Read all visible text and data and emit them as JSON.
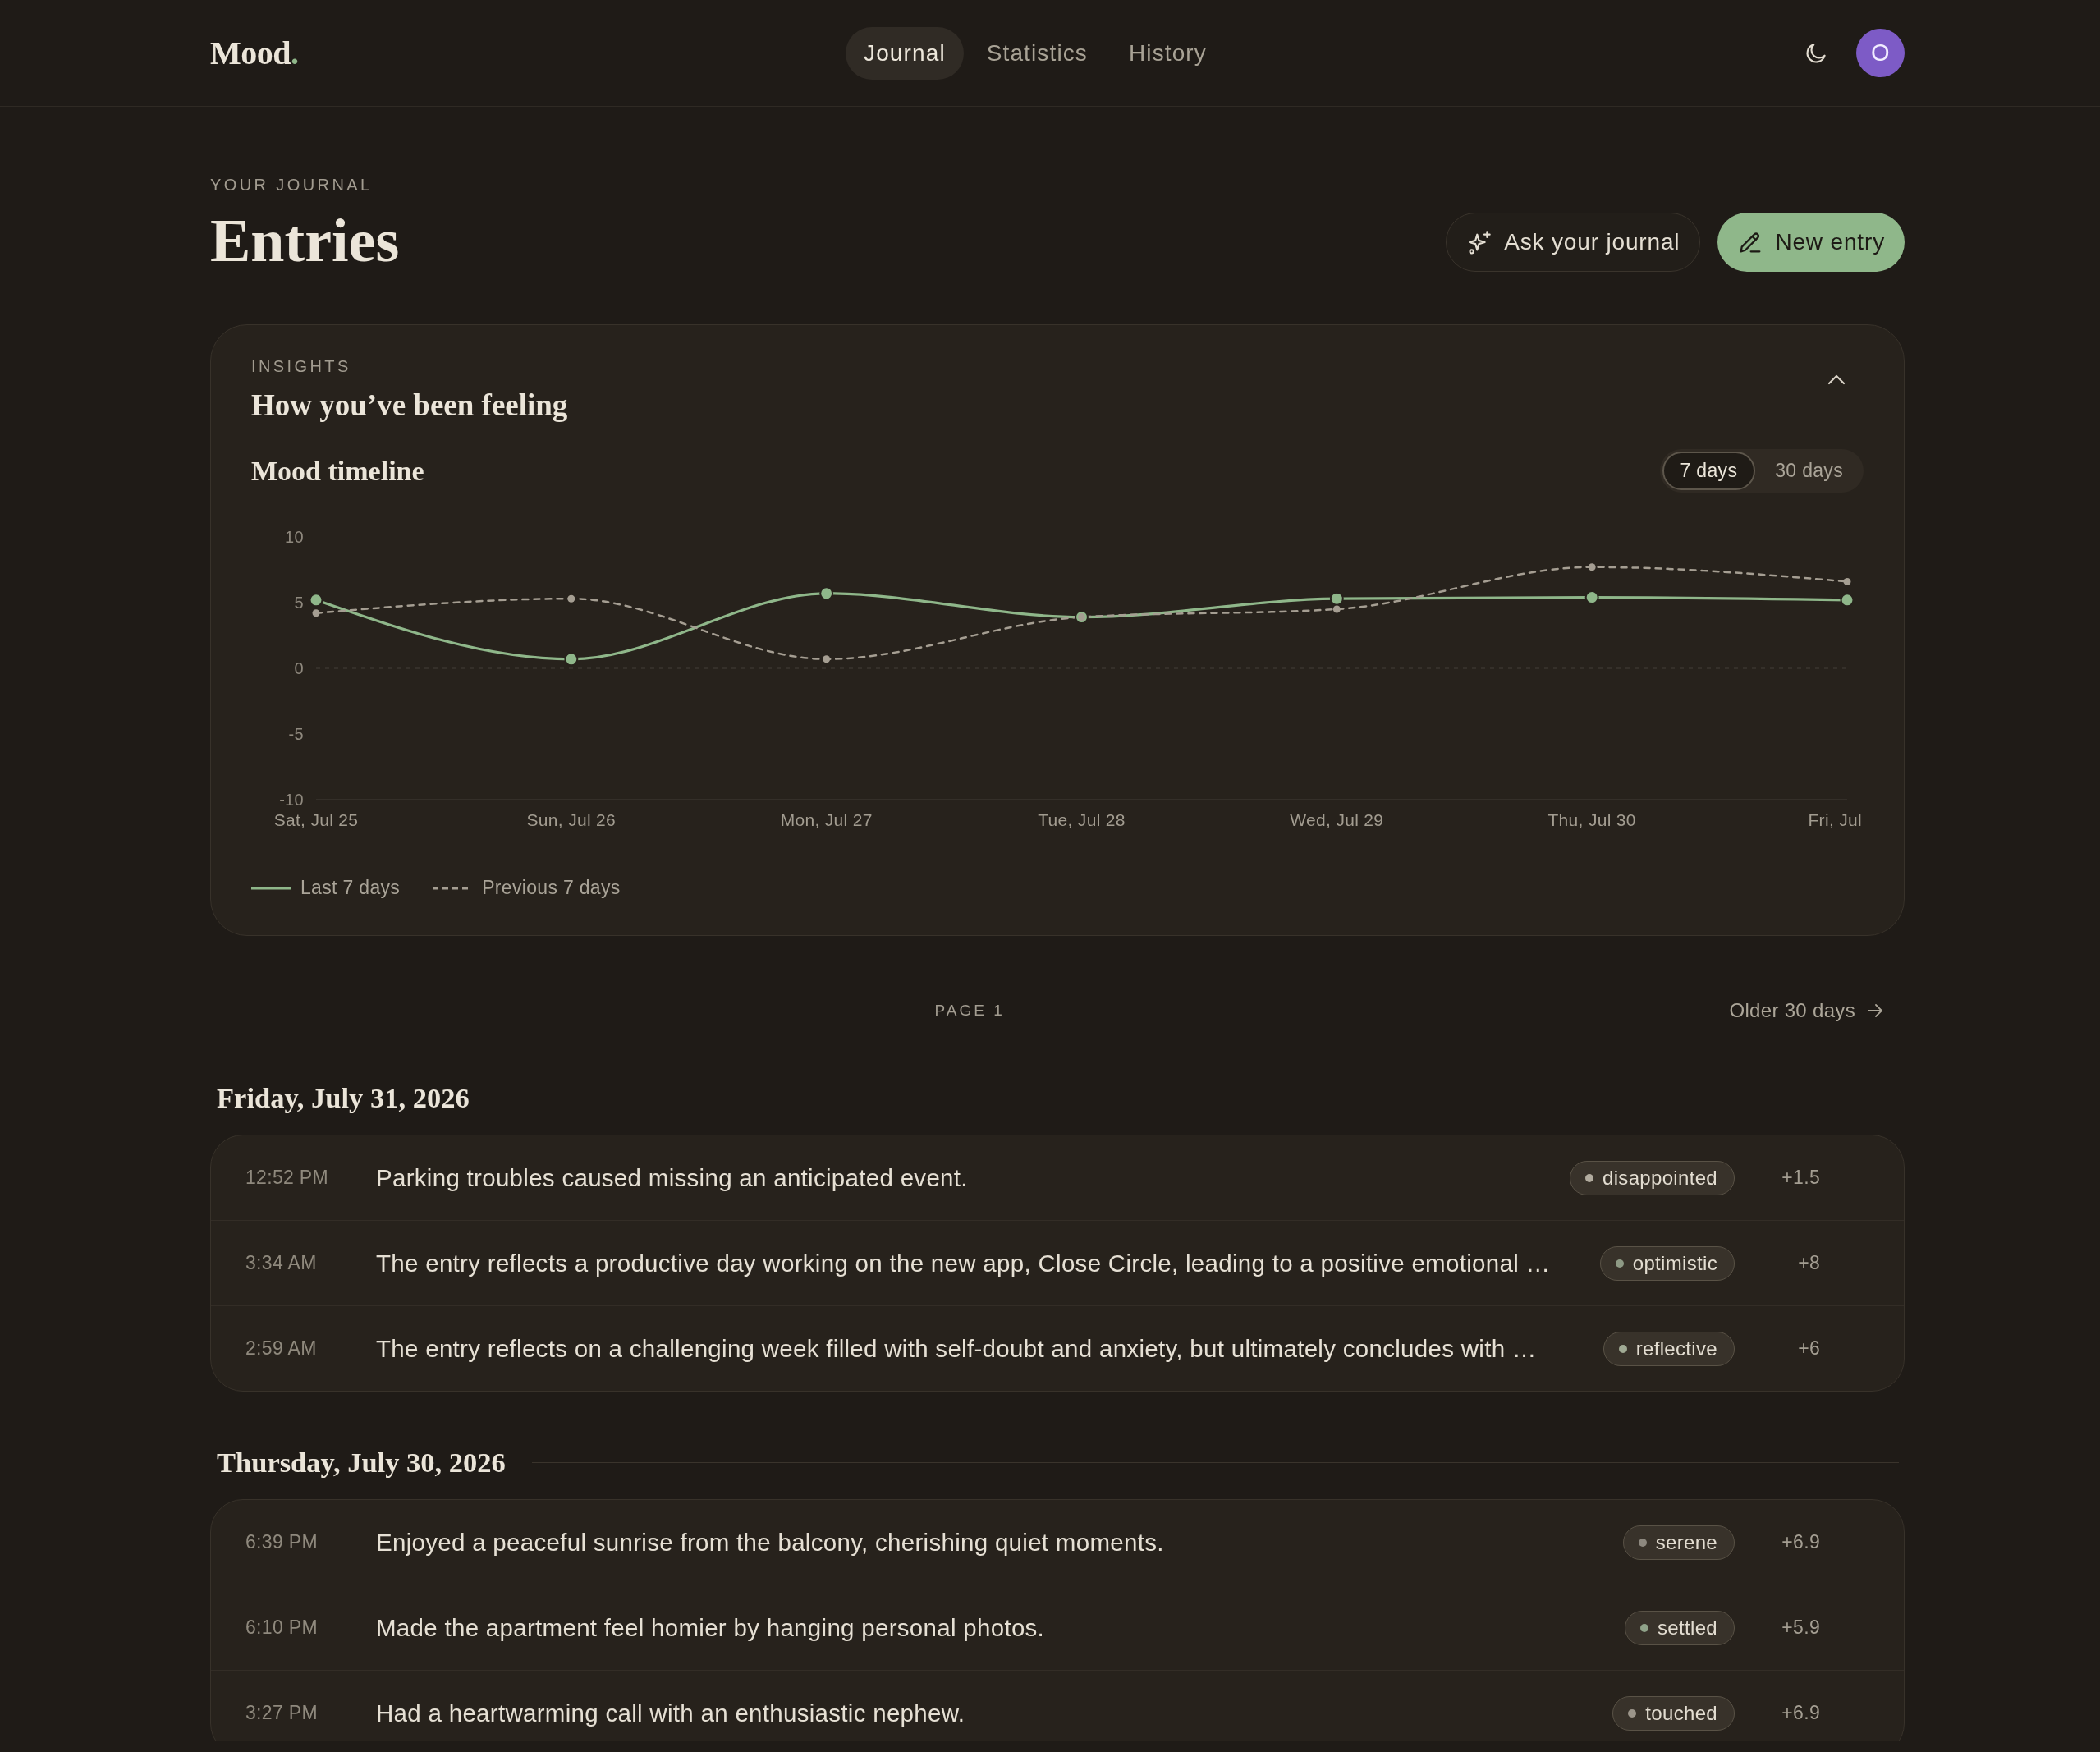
{
  "header": {
    "logo": {
      "name": "Mood",
      "dot": "."
    },
    "tabs": [
      {
        "label": "Journal",
        "selected": true
      },
      {
        "label": "Statistics",
        "selected": false
      },
      {
        "label": "History",
        "selected": false
      }
    ],
    "avatar": {
      "initial": "O"
    }
  },
  "page_header": {
    "eyebrow": "YOUR JOURNAL",
    "title": "Entries",
    "buttons": [
      {
        "label": "Ask your journal",
        "kind": "ask"
      },
      {
        "label": "New entry",
        "kind": "new"
      }
    ]
  },
  "insights": {
    "eyebrow": "INSIGHTS",
    "title": "How you’ve been feeling",
    "expanded": true,
    "ranges": [
      {
        "label": "7 days",
        "selected": true
      },
      {
        "label": "30 days",
        "selected": false
      }
    ],
    "chart_data": {
      "type": "line",
      "title": "Mood timeline",
      "categories": [
        "Sat, Jul 25",
        "Sun, Jul 26",
        "Mon, Jul 27",
        "Tue, Jul 28",
        "Wed, Jul 29",
        "Thu, Jul 30",
        "Fri, Jul"
      ],
      "series": [
        {
          "name": "Last 7 days",
          "color": "#8fb78a",
          "line_style": "solid",
          "marker": "circle",
          "values": [
            5.2,
            0.7,
            5.7,
            3.9,
            5.3,
            5.4,
            5.2
          ]
        },
        {
          "name": "Previous 7 days",
          "color": "#a59e92",
          "line_style": "dashed",
          "marker": "circle",
          "values": [
            4.2,
            5.3,
            0.7,
            3.9,
            4.5,
            7.7,
            6.6
          ]
        }
      ],
      "ylim": [
        -10,
        10
      ],
      "yticks": [
        10,
        5,
        0,
        -5,
        -10
      ]
    }
  },
  "pagination": {
    "page": "PAGE 1",
    "older": "Older 30 days"
  },
  "days": [
    {
      "date": "Friday, July 31, 2026",
      "entries": [
        {
          "time": "12:52 PM",
          "text": "Parking troubles caused missing an anticipated event.",
          "mood": "disappointed",
          "color": "#b2ac9f",
          "score": "+1.5"
        },
        {
          "time": "3:34 AM",
          "text": "The entry reflects a productive day working on the new app, Close Circle, leading to a positive emotional …",
          "mood": "optimistic",
          "color": "#8e9a85",
          "score": "+8"
        },
        {
          "time": "2:59 AM",
          "text": "The entry reflects on a challenging week filled with self-doubt and anxiety, but ultimately concludes with …",
          "mood": "reflective",
          "color": "#a0aa94",
          "score": "+6"
        }
      ]
    },
    {
      "date": "Thursday, July 30, 2026",
      "entries": [
        {
          "time": "6:39 PM",
          "text": "Enjoyed a peaceful sunrise from the balcony, cherishing quiet moments.",
          "mood": "serene",
          "color": "#8d887f",
          "score": "+6.9"
        },
        {
          "time": "6:10 PM",
          "text": "Made the apartment feel homier by hanging personal photos.",
          "mood": "settled",
          "color": "#8fa289",
          "score": "+5.9"
        },
        {
          "time": "3:27 PM",
          "text": "Had a heartwarming call with an enthusiastic nephew.",
          "mood": "touched",
          "color": "#9b958a",
          "score": "+6.9"
        }
      ]
    }
  ]
}
